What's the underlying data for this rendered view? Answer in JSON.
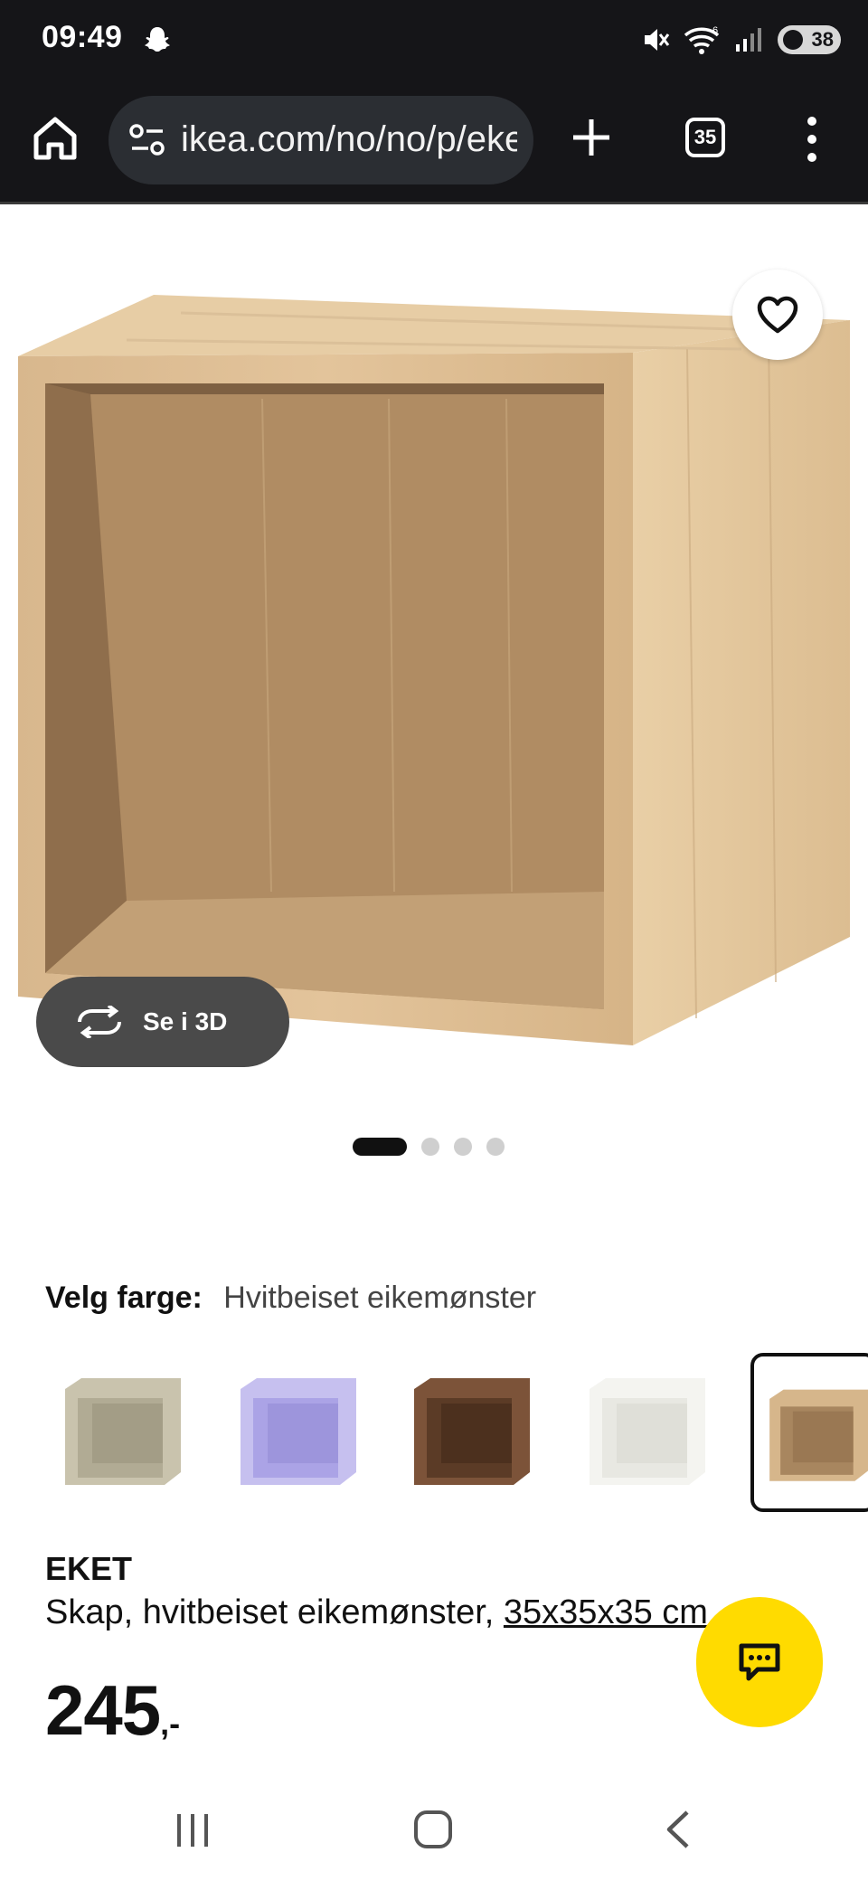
{
  "status_bar": {
    "time": "09:49",
    "battery_level": "38",
    "wifi_badge": "6",
    "icons": [
      "snapchat-icon",
      "mute-icon",
      "wifi-icon",
      "signal-icon",
      "battery-icon"
    ]
  },
  "browser": {
    "url": "ikea.com/no/no/p/eket-skap-hvitbeiset-eikemonster",
    "tab_count": "35",
    "icons": [
      "home-icon",
      "site-settings-icon",
      "new-tab-plus-icon",
      "tab-switcher-icon",
      "more-menu-icon"
    ]
  },
  "gallery": {
    "view_3d_label": "Se i 3D",
    "total_images": 4,
    "active_index": 0
  },
  "color_selector": {
    "label": "Velg farge:",
    "selected_value": "Hvitbeiset eikemønster",
    "swatches": [
      {
        "color": "#c9c3ad"
      },
      {
        "color": "#b9b3e8"
      },
      {
        "color": "#6e4a33"
      },
      {
        "color": "#f1f1ec"
      },
      {
        "color": "#c9a878",
        "selected": true
      }
    ]
  },
  "product": {
    "name": "EKET",
    "description": "Skap, hvitbeiset eikemønster,",
    "dimensions": "35x35x35 cm",
    "price": "245",
    "price_suffix": ",-"
  },
  "colors": {
    "chrome": "#151518",
    "url_pill": "#2b2e33",
    "chat_button": "#ffdb00",
    "view3d_button": "#4a4a4a"
  }
}
